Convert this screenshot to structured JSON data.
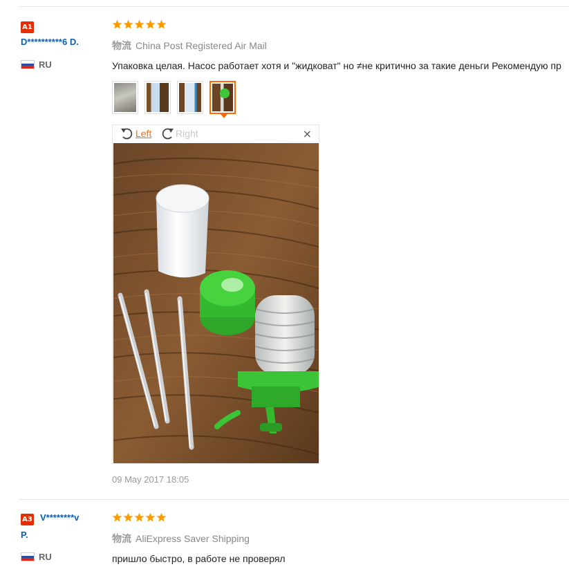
{
  "reviews": [
    {
      "badge": "A1",
      "user": "D**********6 D.",
      "country": "RU",
      "rating": 5,
      "logistics_label": "物流",
      "logistics": "China Post Registered Air Mail",
      "text": "Упаковка целая. Насос работает хотя и \"жидковат\" но ≠не критично за такие деньги Рекомендую пр",
      "viewer": {
        "left_label": "Left",
        "right_label": "Right",
        "close_label": "×"
      },
      "date": "09 May 2017 18:05"
    },
    {
      "badge": "A3",
      "user_line1": "V********v",
      "user_line2": "P.",
      "country": "RU",
      "rating": 5,
      "logistics_label": "物流",
      "logistics": "AliExpress Saver Shipping",
      "text": "пришло быстро, в работе не проверял"
    }
  ],
  "colors": {
    "accent": "#ff6a00",
    "badge": "#e62e04",
    "username": "#0b5fb4",
    "star": "#ff9a00"
  }
}
